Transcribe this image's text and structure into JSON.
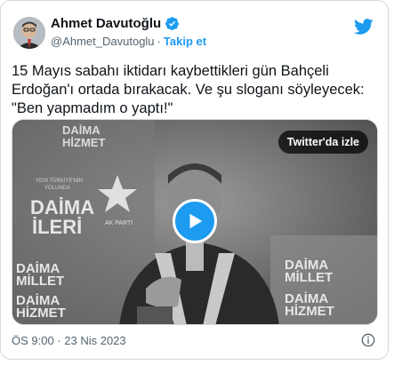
{
  "author": {
    "name": "Ahmet Davutoğlu",
    "handle": "@Ahmet_Davutoglu",
    "separator": "·",
    "follow_label": "Takip et"
  },
  "tweet": {
    "text": "15 Mayıs sabahı iktidarı kaybettikleri gün Bahçeli Erdoğan'ı ortada bırakacak. Ve şu sloganı söyleyecek: \"Ben yapmadım o yaptı!\""
  },
  "media": {
    "watch_label": "Twitter'da izle",
    "background_text": {
      "left_top": "DAİMA\nHİZMET",
      "left_middle": "DAİMA\nİLERİ",
      "left_small": "YENİ TÜRKİYE'NİN\nYOLUNDA",
      "left_bottom_1": "DAİMA\nMİLLET",
      "left_bottom_2": "DAİMA\nHİZMET",
      "right_bottom_1": "DAİMA\nMİLLET",
      "right_bottom_2": "DAİMA\nHİZMET"
    }
  },
  "footer": {
    "timestamp": "ÖS 9:00 · 23 Nis 2023"
  },
  "icons": {
    "verified": "verified-badge-icon",
    "bird": "twitter-bird-icon",
    "play": "play-icon",
    "info": "info-icon"
  },
  "colors": {
    "accent": "#1d9bf0",
    "text": "#0f1419",
    "secondary": "#536471",
    "border": "#cfd9de"
  }
}
